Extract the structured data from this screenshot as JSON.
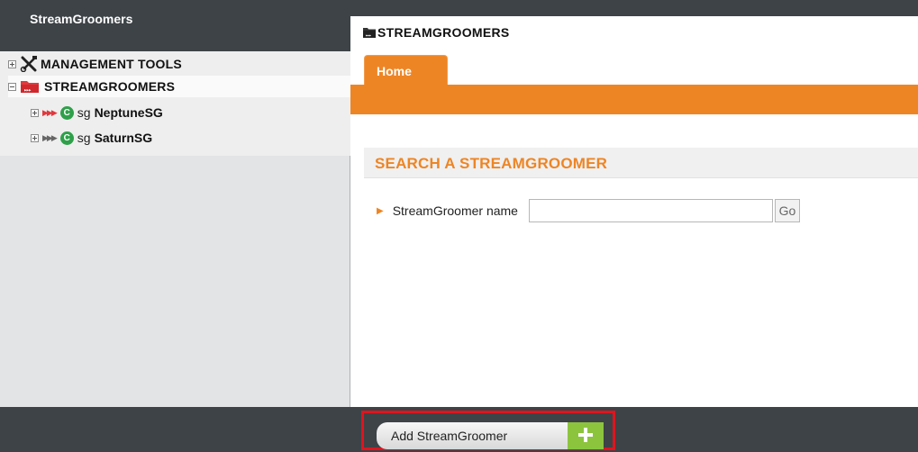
{
  "sidebar": {
    "title": "StreamGroomers",
    "tree": [
      {
        "label": "MANAGEMENT TOOLS",
        "expanded": false,
        "icon": "tools-icon"
      },
      {
        "label": "STREAMGROOMERS",
        "expanded": true,
        "icon": "red-folder-icon",
        "selected": true
      },
      {
        "prefix": "sg",
        "label": "NeptuneSG",
        "status": "C",
        "arrows": "red"
      },
      {
        "prefix": "sg",
        "label": "SaturnSG",
        "status": "C",
        "arrows": "grey"
      }
    ]
  },
  "main": {
    "title": "STREAMGROOMERS",
    "tabs": [
      {
        "label": "Home",
        "active": true
      }
    ],
    "section_title": "SEARCH A STREAMGROOMER",
    "search": {
      "label": "StreamGroomer name",
      "value": "",
      "placeholder": "",
      "go_label": "Go"
    }
  },
  "footer": {
    "add_button_label": "Add StreamGroomer"
  },
  "colors": {
    "accent": "#ee8524",
    "dark": "#3d4347",
    "status_green": "#2fa04a",
    "add_green": "#8cc43e",
    "highlight": "#e0141e"
  }
}
